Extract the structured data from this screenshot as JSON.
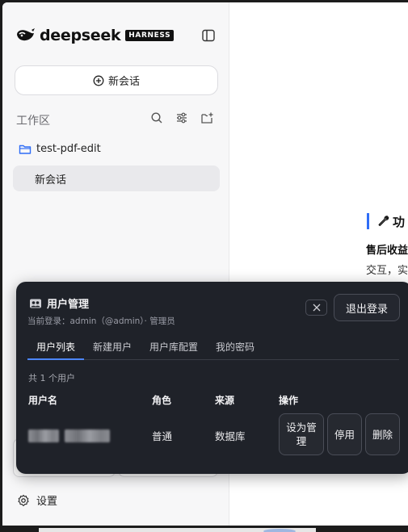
{
  "sidebar": {
    "brand": "deepseek",
    "badge": "HARNESS",
    "new_chat_label": "新会话",
    "workspace_label": "工作区",
    "folder_name": "test-pdf-edit",
    "session_label": "新会话",
    "settings_label": "设置"
  },
  "main": {
    "heading": "功",
    "subheading": "售后收益",
    "line": "交互，实"
  },
  "modal": {
    "title": "用户管理",
    "login_info": "当前登录：admin（@admin）· 管理员",
    "logout_label": "退出登录",
    "tabs": [
      {
        "label": "用户列表",
        "active": true
      },
      {
        "label": "新建用户",
        "active": false
      },
      {
        "label": "用户库配置",
        "active": false
      },
      {
        "label": "我的密码",
        "active": false
      }
    ],
    "count_text": "共 1 个用户",
    "columns": [
      "用户名",
      "角色",
      "来源",
      "操作"
    ],
    "rows": [
      {
        "role": "普通",
        "source": "数据库",
        "actions": [
          "设为管理",
          "停用",
          "删除"
        ]
      }
    ]
  },
  "colors": {
    "accent": "#4d86ff",
    "modal_bg": "#1f2229",
    "sidebar_bg": "#f7f7f8",
    "heading_bar": "#2f6df6"
  },
  "icons": [
    "whale-logo-icon",
    "sidebar-toggle-icon",
    "plus-circle-icon",
    "search-icon",
    "filter-icon",
    "new-folder-icon",
    "folder-icon",
    "gear-icon",
    "wrench-icon",
    "users-icon",
    "close-icon"
  ]
}
